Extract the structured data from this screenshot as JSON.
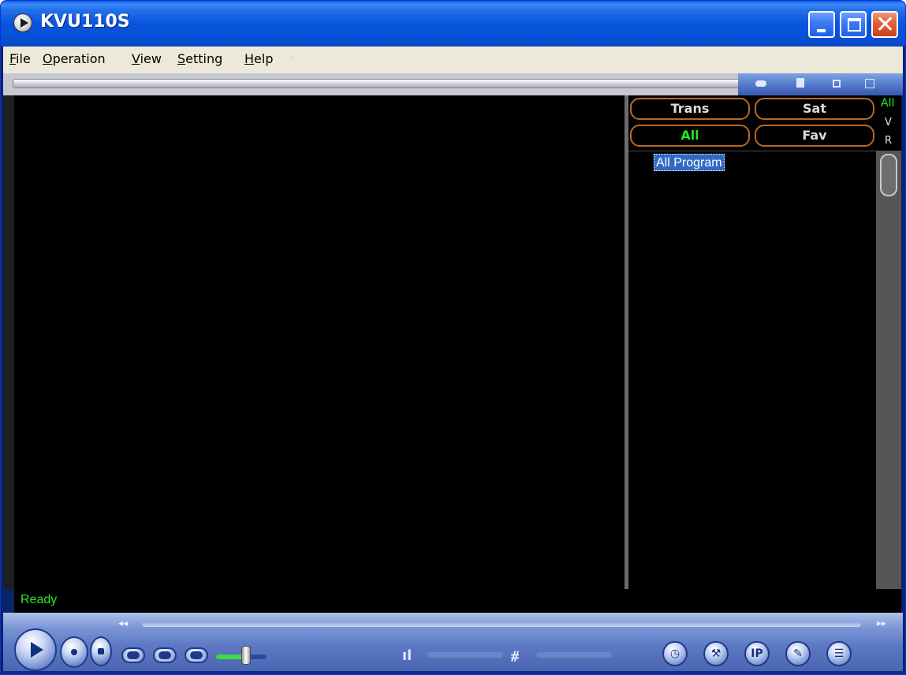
{
  "window": {
    "title": "KVU110S",
    "icon": "play-circle-icon",
    "buttons": {
      "minimize": "minimize-icon",
      "maximize": "maximize-icon",
      "close": "close-icon"
    }
  },
  "menu": {
    "items": [
      {
        "label": "File",
        "mnemonic": "F"
      },
      {
        "label": "Operation",
        "mnemonic": "O"
      },
      {
        "label": "View",
        "mnemonic": "V"
      },
      {
        "label": "Setting",
        "mnemonic": "S"
      },
      {
        "label": "Help",
        "mnemonic": "H"
      }
    ]
  },
  "toolbar_icons": [
    "snapshot-icon",
    "record-icon",
    "screen-icon",
    "window-icon"
  ],
  "channel_panel": {
    "filters": {
      "trans": "Trans",
      "sat": "Sat",
      "all": "All",
      "fav": "Fav"
    },
    "active_filter": "All",
    "side_letters": {
      "all": "All",
      "v": "V",
      "r": "R"
    },
    "tree": {
      "selected_item": "All Program"
    }
  },
  "status": {
    "text": "Ready"
  },
  "player": {
    "buttons": [
      "play-icon",
      "pause-icon",
      "stop-icon",
      "prev-icon",
      "next-icon",
      "eject-icon"
    ],
    "volume_level": 0.6,
    "signal_label": "ıl",
    "audio_label": "⧣",
    "right_buttons": [
      "clock-icon",
      "wrench-icon",
      "ip-icon",
      "epg-icon",
      "list-icon"
    ]
  },
  "colors": {
    "title_bar": "#0855dd",
    "menu_bg": "#ece9d8",
    "active_text": "#27e827",
    "pill_border": "#b86a26",
    "selection": "#316ac5"
  }
}
